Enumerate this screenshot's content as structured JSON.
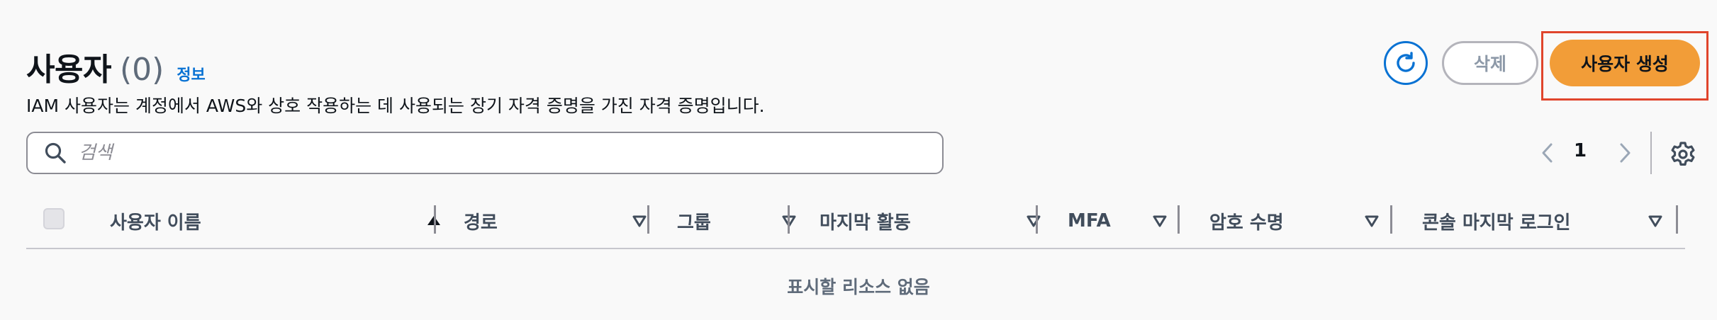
{
  "header": {
    "title": "사용자",
    "count": "(0)",
    "info_link": "정보",
    "description": "IAM 사용자는 계정에서 AWS와 상호 작용하는 데 사용되는 장기 자격 증명을 가진 자격 증명입니다."
  },
  "actions": {
    "refresh_icon": "refresh-icon",
    "delete_label": "삭제",
    "create_label": "사용자 생성"
  },
  "search": {
    "placeholder": "검색",
    "value": ""
  },
  "pagination": {
    "current_page": "1"
  },
  "table": {
    "columns": [
      {
        "label": "사용자 이름",
        "sort": "ascending"
      },
      {
        "label": "경로",
        "sort": "none"
      },
      {
        "label": "그룹",
        "sort": "none"
      },
      {
        "label": "마지막 활동",
        "sort": "none"
      },
      {
        "label": "MFA",
        "sort": "none"
      },
      {
        "label": "암호 수명",
        "sort": "none"
      },
      {
        "label": "콘솔 마지막 로그인",
        "sort": "none"
      }
    ],
    "empty_text": "표시할 리소스 없음"
  },
  "colors": {
    "accent": "#0972d3",
    "primary_button": "#f29d38",
    "highlight_border": "#e0452c"
  }
}
